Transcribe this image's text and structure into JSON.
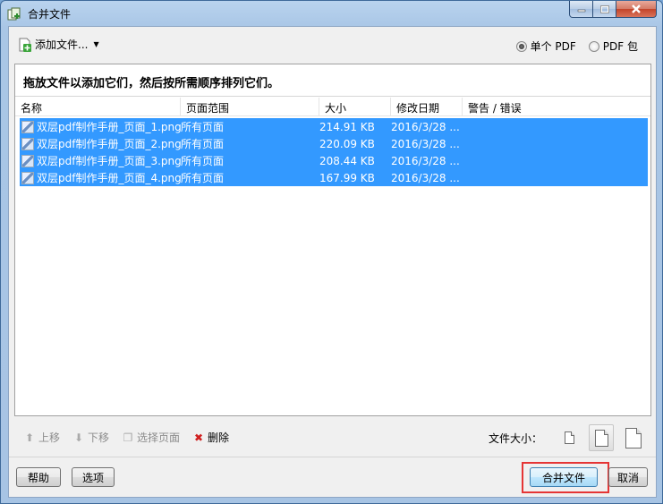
{
  "window": {
    "title": "合并文件"
  },
  "toolbar": {
    "add_files_label": "添加文件..."
  },
  "output_mode": {
    "options": [
      "单个 PDF",
      "PDF 包"
    ],
    "selected_index": 0
  },
  "instruction": "拖放文件以添加它们，然后按所需顺序排列它们。",
  "table": {
    "columns": [
      "名称",
      "页面范围",
      "大小",
      "修改日期",
      "警告 / 错误"
    ],
    "rows": [
      {
        "name": "双层pdf制作手册_页面_1.png",
        "range": "所有页面",
        "size": "214.91 KB",
        "date": "2016/3/28 ...",
        "warn": ""
      },
      {
        "name": "双层pdf制作手册_页面_2.png",
        "range": "所有页面",
        "size": "220.09 KB",
        "date": "2016/3/28 ...",
        "warn": ""
      },
      {
        "name": "双层pdf制作手册_页面_3.png",
        "range": "所有页面",
        "size": "208.44 KB",
        "date": "2016/3/28 ...",
        "warn": ""
      },
      {
        "name": "双层pdf制作手册_页面_4.png",
        "range": "所有页面",
        "size": "167.99 KB",
        "date": "2016/3/28 ...",
        "warn": ""
      }
    ]
  },
  "actions": {
    "move_up": "上移",
    "move_down": "下移",
    "choose_pages": "选择页面",
    "delete": "删除"
  },
  "file_size": {
    "label": "文件大小：",
    "selected_index": 1
  },
  "buttons": {
    "help": "帮助",
    "options": "选项",
    "combine": "合并文件",
    "cancel": "取消"
  },
  "colors": {
    "selection": "#3399ff",
    "highlight": "#e53535"
  }
}
